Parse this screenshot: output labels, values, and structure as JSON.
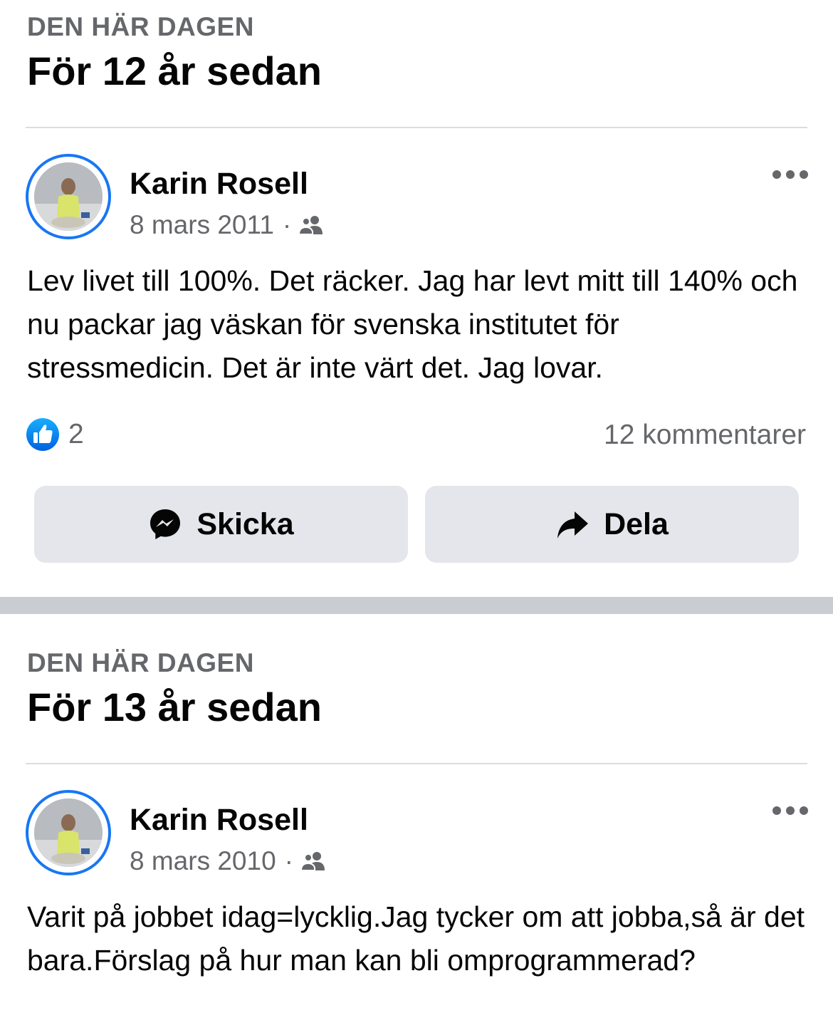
{
  "colors": {
    "accent": "#1877f2",
    "secondary_text": "#65676b",
    "button_bg": "#e4e6eb",
    "separator": "#c9ccd1"
  },
  "memories": [
    {
      "kicker": "DEN HÄR DAGEN",
      "title": "För 12 år sedan",
      "post": {
        "author": "Karin Rosell",
        "date": "8 mars 2011",
        "separator": "·",
        "audience_icon": "friends-icon",
        "text": "Lev livet till 100%. Det räcker. Jag har levt mitt till 140% och nu packar jag väskan för svenska institutet för stressmedicin. Det är inte värt det. Jag lovar.",
        "like_count": "2",
        "comments": "12 kommentarer",
        "send_label": "Skicka",
        "share_label": "Dela"
      }
    },
    {
      "kicker": "DEN HÄR DAGEN",
      "title": "För 13 år sedan",
      "post": {
        "author": "Karin Rosell",
        "date": "8 mars 2010",
        "separator": "·",
        "audience_icon": "friends-icon",
        "text": "Varit på jobbet idag=lycklig.Jag tycker om att jobba,så är det bara.Förslag på hur man kan bli omprogrammerad?"
      }
    }
  ]
}
